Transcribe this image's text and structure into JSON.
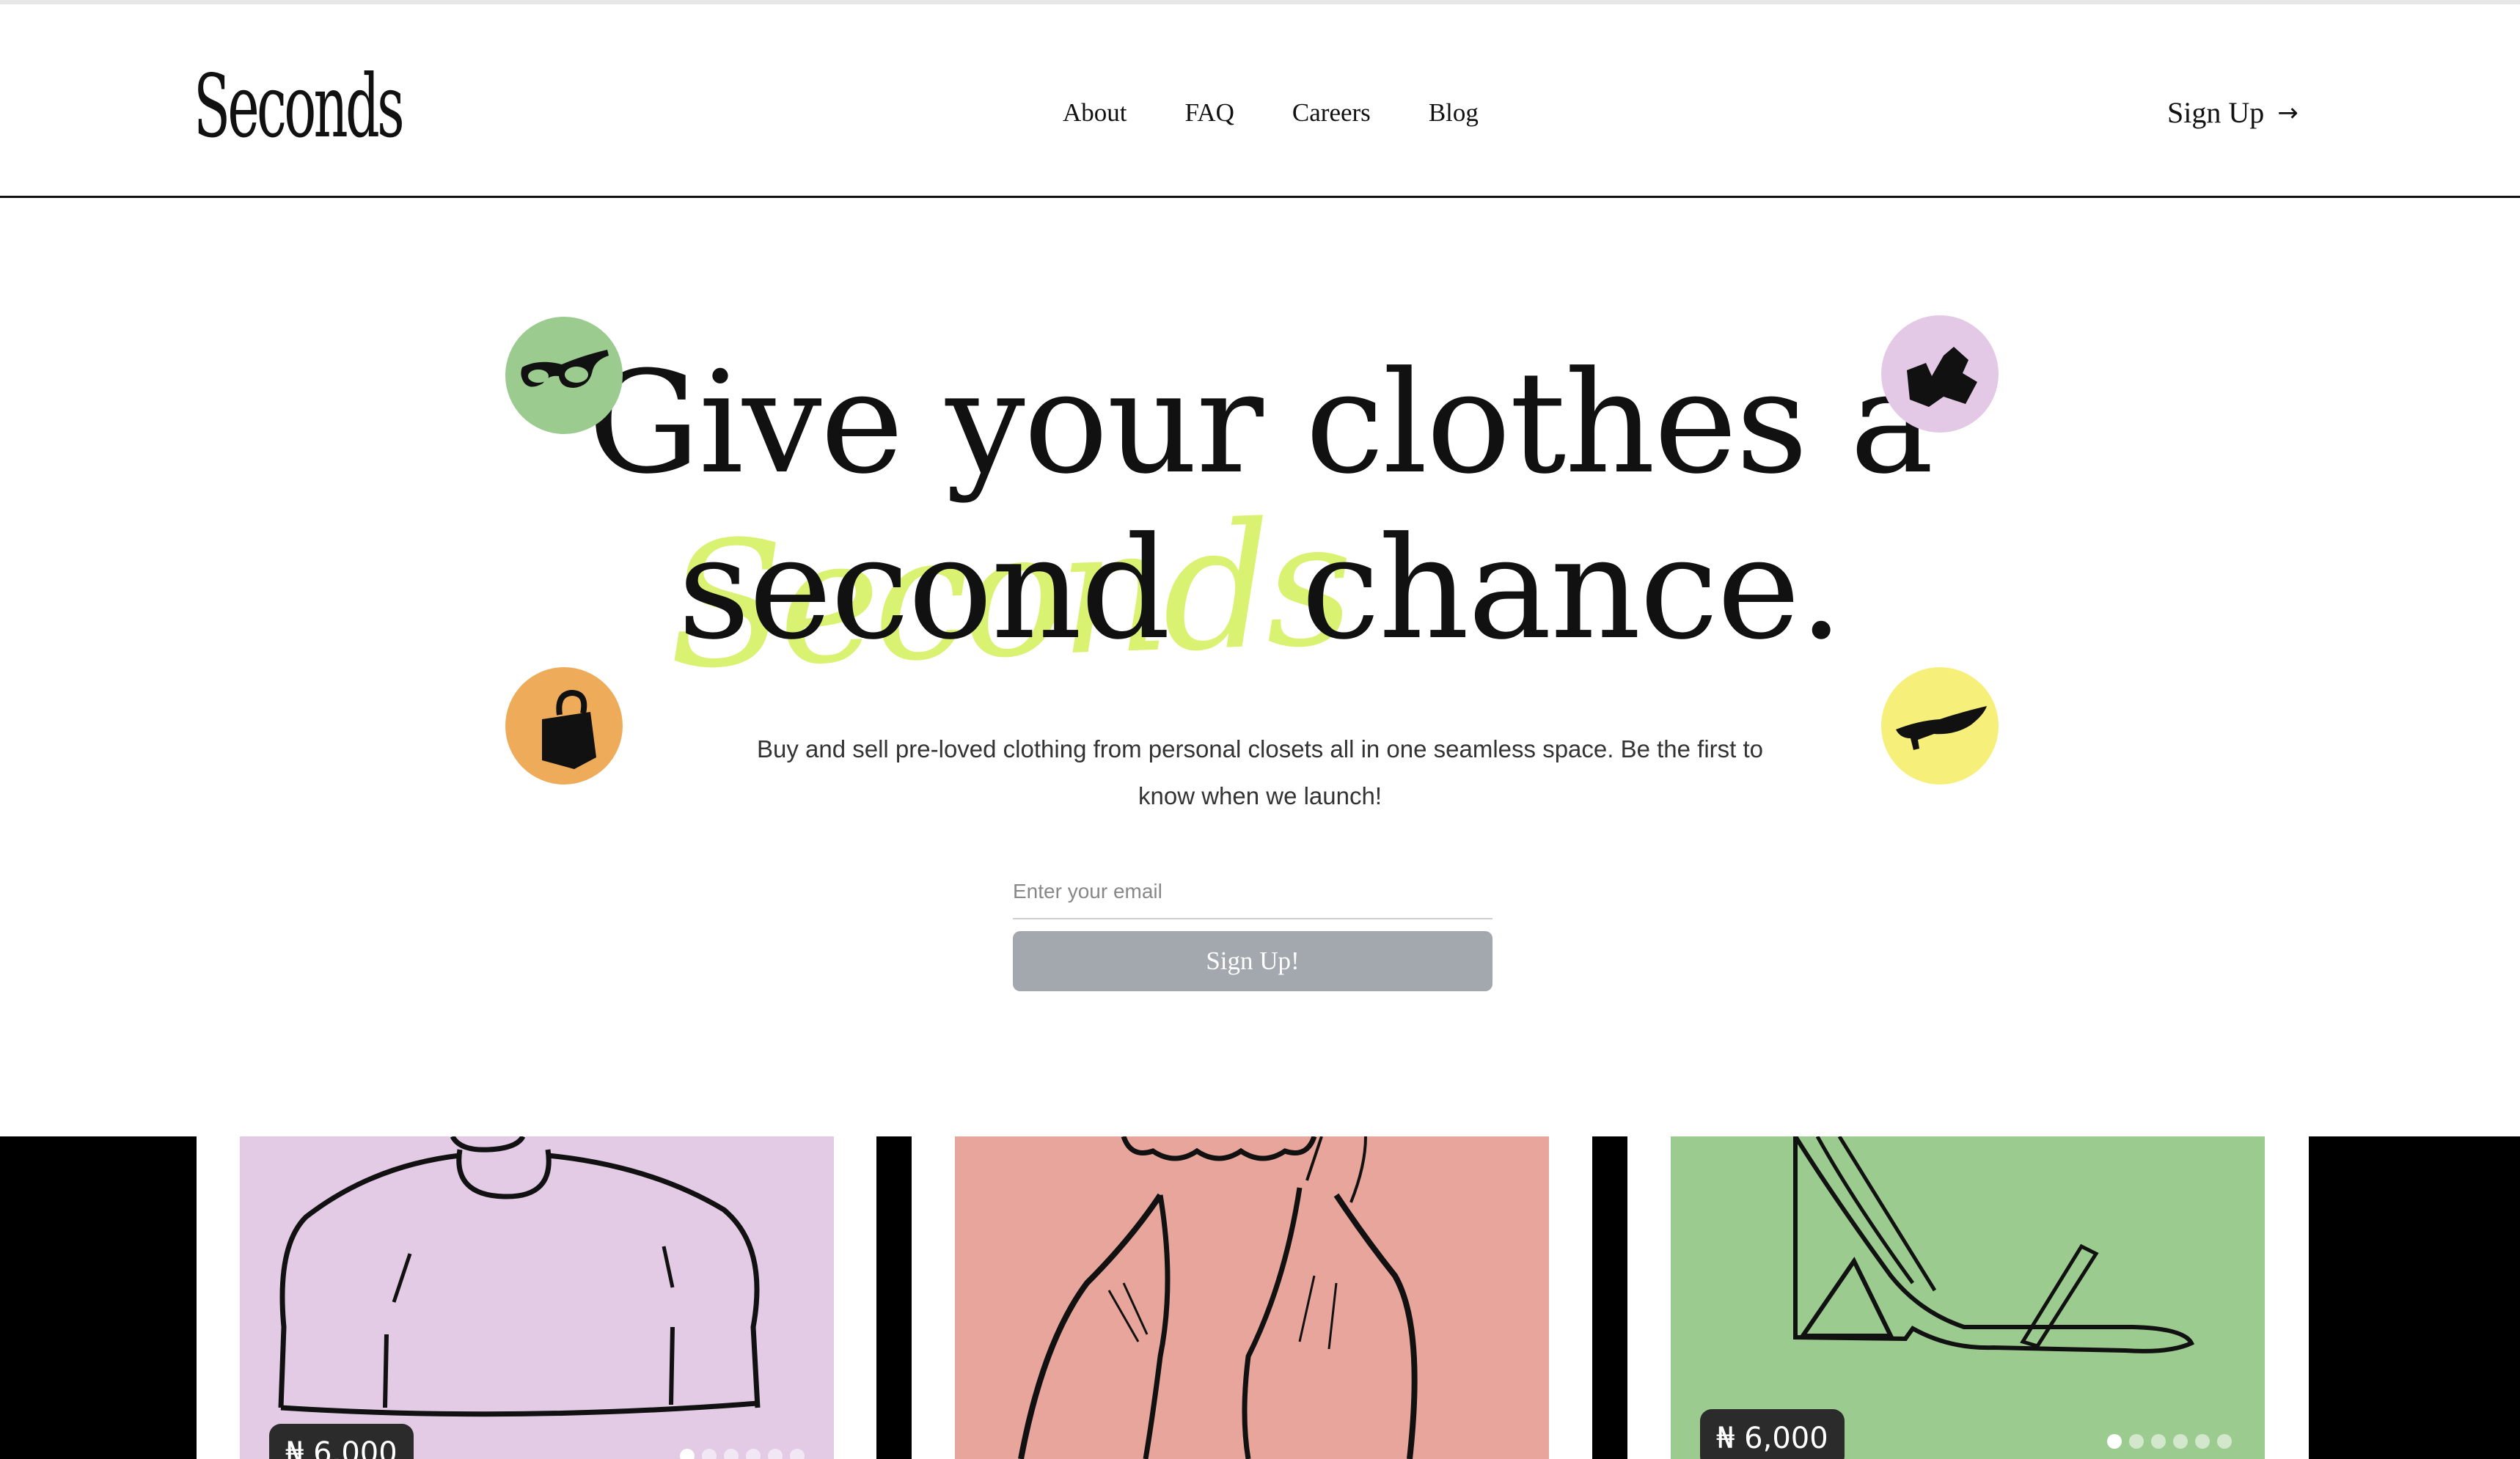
{
  "brand": {
    "logo": "Seconds"
  },
  "nav": {
    "items": [
      "About",
      "FAQ",
      "Careers",
      "Blog"
    ]
  },
  "header": {
    "signup_label": "Sign Up",
    "signup_icon": "arrow-right-icon"
  },
  "hero": {
    "line1": "Give your clothes a",
    "line2_a": "second",
    "line2_b": "chance.",
    "scribble": "Seconds",
    "subtitle": "Buy and sell pre-loved clothing from personal closets all in one seamless space. Be the first to know when we launch!",
    "badges": [
      {
        "icon": "sunglasses-icon",
        "color": "#9ccb8f"
      },
      {
        "icon": "gloves-icon",
        "color": "#e3c9e6"
      },
      {
        "icon": "handbag-icon",
        "color": "#eeac5b"
      },
      {
        "icon": "heel-shoe-icon",
        "color": "#f6f07a"
      }
    ]
  },
  "form": {
    "email_placeholder": "Enter your email",
    "button_label": "Sign Up!"
  },
  "products": [
    {
      "name": "top",
      "bg": "#e3cbe6",
      "price": "₦ 6,000",
      "slides": 6,
      "active": 0
    },
    {
      "name": "dress",
      "bg": "#e8a59b",
      "price": "",
      "slides": 0,
      "active": 0
    },
    {
      "name": "heel",
      "bg": "#9ccb8f",
      "price": "₦ 6,000",
      "slides": 6,
      "active": 0
    }
  ],
  "colors": {
    "accent_scribble": "#d8f26a",
    "button_disabled": "#a3a8ae",
    "text": "#111111"
  }
}
